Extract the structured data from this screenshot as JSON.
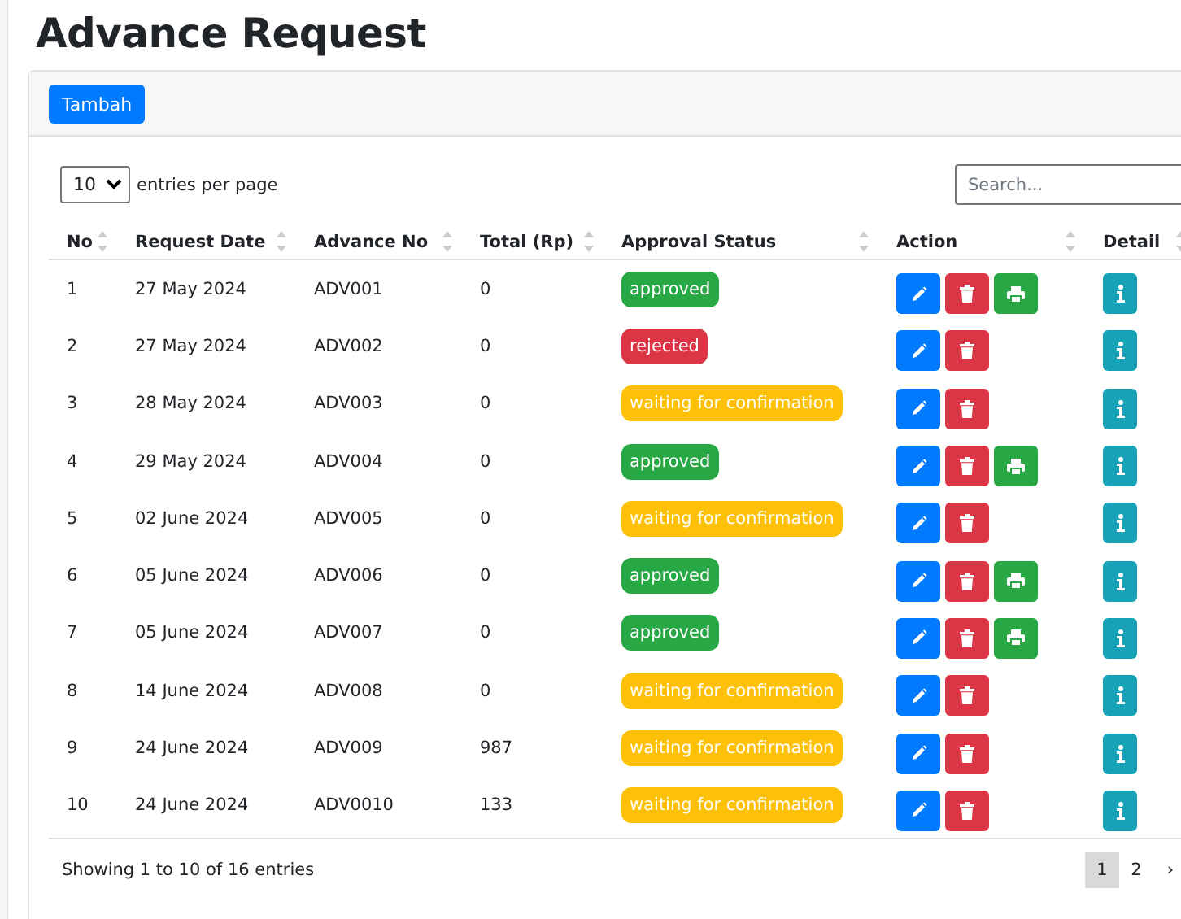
{
  "page_title": "Advance Request",
  "add_button": "Tambah",
  "page_length": {
    "value": "10",
    "label": "entries per page"
  },
  "search": {
    "placeholder": "Search..."
  },
  "table": {
    "columns": [
      "No",
      "Request Date",
      "Advance No",
      "Total (Rp)",
      "Approval Status",
      "Action",
      "Detail"
    ],
    "rows": [
      {
        "no": "1",
        "date": "27 May 2024",
        "advance_no": "ADV001",
        "total": "0",
        "status": {
          "kind": "approved",
          "text": "approved"
        },
        "actions": [
          {
            "kind": "edit"
          },
          {
            "kind": "delete"
          },
          {
            "kind": "print"
          }
        ]
      },
      {
        "no": "2",
        "date": "27 May 2024",
        "advance_no": "ADV002",
        "total": "0",
        "status": {
          "kind": "rejected",
          "text": "rejected"
        },
        "actions": [
          {
            "kind": "edit"
          },
          {
            "kind": "delete"
          }
        ]
      },
      {
        "no": "3",
        "date": "28 May 2024",
        "advance_no": "ADV003",
        "total": "0",
        "status": {
          "kind": "waiting",
          "text": "waiting for confirmation"
        },
        "actions": [
          {
            "kind": "edit"
          },
          {
            "kind": "delete"
          }
        ]
      },
      {
        "no": "4",
        "date": "29 May 2024",
        "advance_no": "ADV004",
        "total": "0",
        "status": {
          "kind": "approved",
          "text": "approved"
        },
        "actions": [
          {
            "kind": "edit"
          },
          {
            "kind": "delete"
          },
          {
            "kind": "print"
          }
        ]
      },
      {
        "no": "5",
        "date": "02 June 2024",
        "advance_no": "ADV005",
        "total": "0",
        "status": {
          "kind": "waiting",
          "text": "waiting for confirmation"
        },
        "actions": [
          {
            "kind": "edit"
          },
          {
            "kind": "delete"
          }
        ]
      },
      {
        "no": "6",
        "date": "05 June 2024",
        "advance_no": "ADV006",
        "total": "0",
        "status": {
          "kind": "approved",
          "text": "approved"
        },
        "actions": [
          {
            "kind": "edit"
          },
          {
            "kind": "delete"
          },
          {
            "kind": "print"
          }
        ]
      },
      {
        "no": "7",
        "date": "05 June 2024",
        "advance_no": "ADV007",
        "total": "0",
        "status": {
          "kind": "approved",
          "text": "approved"
        },
        "actions": [
          {
            "kind": "edit"
          },
          {
            "kind": "delete"
          },
          {
            "kind": "print"
          }
        ]
      },
      {
        "no": "8",
        "date": "14 June 2024",
        "advance_no": "ADV008",
        "total": "0",
        "status": {
          "kind": "waiting",
          "text": "waiting for confirmation"
        },
        "actions": [
          {
            "kind": "edit"
          },
          {
            "kind": "delete"
          }
        ]
      },
      {
        "no": "9",
        "date": "24 June 2024",
        "advance_no": "ADV009",
        "total": "987",
        "status": {
          "kind": "waiting",
          "text": "waiting for confirmation"
        },
        "actions": [
          {
            "kind": "edit"
          },
          {
            "kind": "delete"
          }
        ]
      },
      {
        "no": "10",
        "date": "24 June 2024",
        "advance_no": "ADV0010",
        "total": "133",
        "status": {
          "kind": "waiting",
          "text": "waiting for confirmation"
        },
        "actions": [
          {
            "kind": "edit"
          },
          {
            "kind": "delete"
          }
        ]
      }
    ]
  },
  "info": "Showing 1 to 10 of 16 entries",
  "pagination": [
    {
      "label": "1",
      "selected": true
    },
    {
      "label": "2",
      "selected": false
    },
    {
      "label": "›",
      "selected": false
    }
  ]
}
